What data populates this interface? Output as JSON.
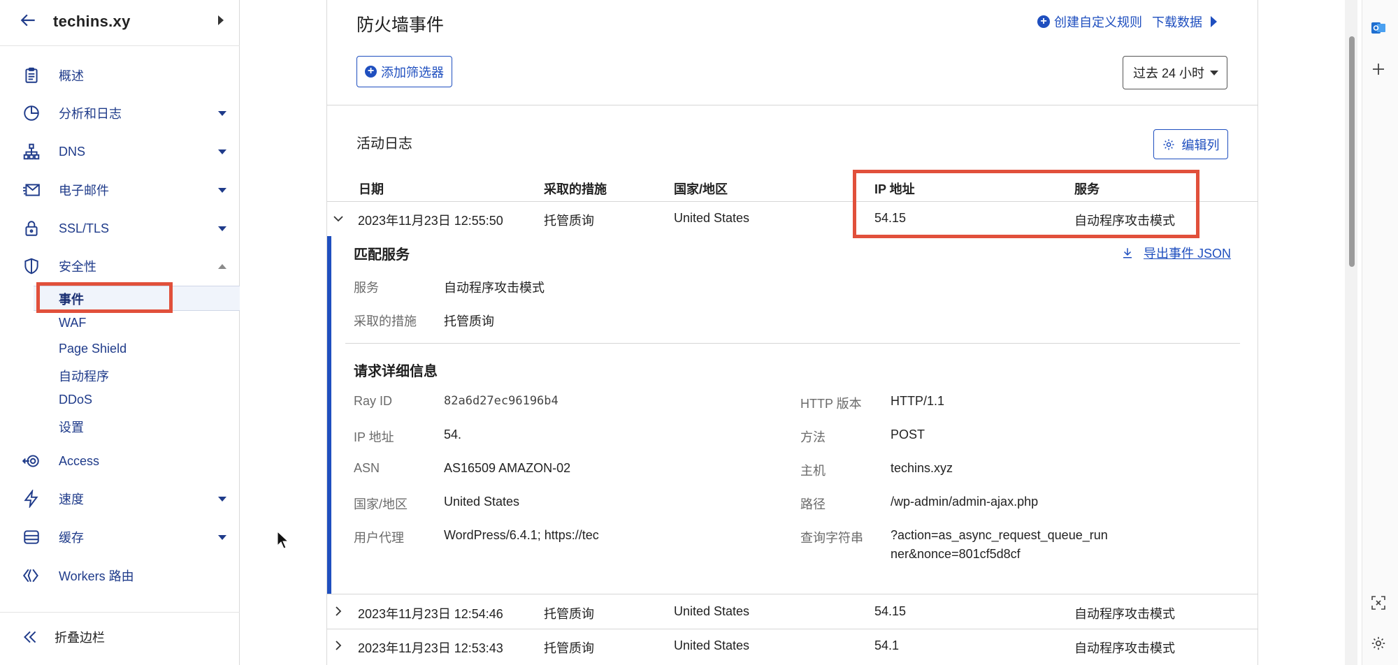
{
  "sidebar": {
    "domain": "techins.xy",
    "items": [
      {
        "label": "概述"
      },
      {
        "label": "分析和日志"
      },
      {
        "label": "DNS"
      },
      {
        "label": "电子邮件"
      },
      {
        "label": "SSL/TLS"
      },
      {
        "label": "安全性"
      },
      {
        "label": "Access"
      },
      {
        "label": "速度"
      },
      {
        "label": "缓存"
      },
      {
        "label": "Workers 路由"
      }
    ],
    "security_sub": [
      "事件",
      "WAF",
      "Page Shield",
      "自动程序",
      "DDoS",
      "设置"
    ],
    "collapse_label": "折叠边栏"
  },
  "header": {
    "title": "防火墙事件",
    "create_rule": "创建自定义规则",
    "download": "下载数据",
    "add_filter": "添加筛选器",
    "time_range": "过去 24 小时"
  },
  "activity": {
    "title": "活动日志",
    "edit_columns": "编辑列",
    "columns": [
      "日期",
      "采取的措施",
      "国家/地区",
      "IP 地址",
      "服务"
    ],
    "rows": [
      {
        "date": "2023年11月23日 12:55:50",
        "action": "托管质询",
        "country": "United States",
        "ip": "54.15",
        "service": "自动程序攻击模式"
      },
      {
        "date": "2023年11月23日 12:54:46",
        "action": "托管质询",
        "country": "United States",
        "ip": "54.15",
        "service": "自动程序攻击模式"
      },
      {
        "date": "2023年11月23日 12:53:43",
        "action": "托管质询",
        "country": "United States",
        "ip": "54.1",
        "service": "自动程序攻击模式"
      }
    ]
  },
  "detail": {
    "match_title": "匹配服务",
    "export_json": "导出事件 JSON",
    "match": [
      {
        "k": "服务",
        "v": "自动程序攻击模式"
      },
      {
        "k": "采取的措施",
        "v": "托管质询"
      }
    ],
    "request_title": "请求详细信息",
    "left": [
      {
        "k": "Ray ID",
        "v": "82a6d27ec96196b4"
      },
      {
        "k": "IP 地址",
        "v": "54."
      },
      {
        "k": "ASN",
        "v": "AS16509 AMAZON-02"
      },
      {
        "k": "国家/地区",
        "v": "United States"
      },
      {
        "k": "用户代理",
        "v": "WordPress/6.4.1; https://tec"
      }
    ],
    "right": [
      {
        "k": "HTTP 版本",
        "v": "HTTP/1.1"
      },
      {
        "k": "方法",
        "v": "POST"
      },
      {
        "k": "主机",
        "v": "techins.xyz"
      },
      {
        "k": "路径",
        "v": "/wp-admin/admin-ajax.php"
      },
      {
        "k": "查询字符串",
        "v": "?action=as_async_request_queue_run",
        "v2": "ner&nonce=801cf5d8cf"
      }
    ]
  },
  "colors": {
    "accent": "#1f4fbf",
    "highlight": "#e1503b",
    "nav": "#1f3b8a"
  }
}
